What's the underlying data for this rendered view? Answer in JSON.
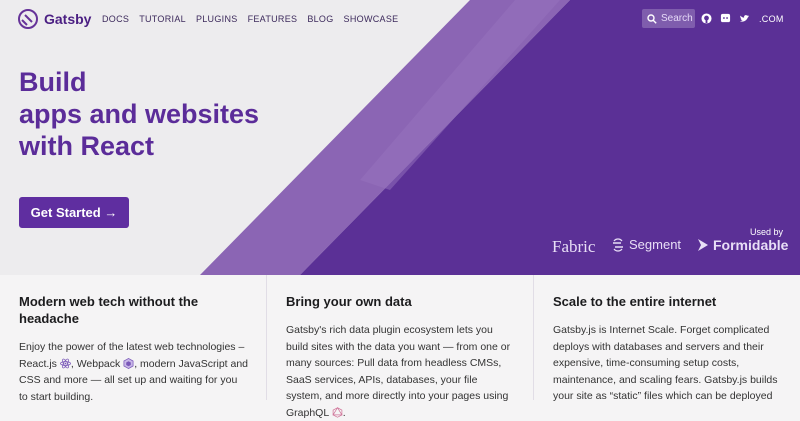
{
  "brand": {
    "name": "Gatsby"
  },
  "nav": {
    "links": [
      {
        "label": "DOCS"
      },
      {
        "label": "TUTORIAL"
      },
      {
        "label": "PLUGINS"
      },
      {
        "label": "FEATURES"
      },
      {
        "label": "BLOG"
      },
      {
        "label": "SHOWCASE"
      }
    ],
    "search_placeholder": "Search",
    "domain": ".COM"
  },
  "hero": {
    "headline": "Build\napps and websites\nwith React",
    "cta_label": "Get Started →",
    "used_by_label": "Used by",
    "partners": [
      {
        "name": "Fabric"
      },
      {
        "name": "Segment"
      },
      {
        "name": "Formidable"
      }
    ]
  },
  "features": [
    {
      "title": "Modern web tech without the headache",
      "text_parts": [
        "Enjoy the power of the latest web technologies – React.js ",
        ", Webpack ",
        ", modern JavaScript and CSS and more — all set up and waiting for you to start building."
      ]
    },
    {
      "title": "Bring your own data",
      "text_parts": [
        "Gatsby's rich data plugin ecosystem lets you build sites with the data you want — from one or many sources: Pull data from headless CMSs, SaaS services, APIs, databases, your file system, and more directly into your pages using GraphQL ",
        "."
      ]
    },
    {
      "title": "Scale to the entire internet",
      "text_parts": [
        "Gatsby.js is Internet Scale. Forget complicated deploys with databases and servers and their expensive, time-consuming setup costs, maintenance, and scaling fears. Gatsby.js builds your site as “static” files which can be deployed"
      ]
    }
  ],
  "colors": {
    "brand_purple": "#663399",
    "hero_dark": "#5b3096",
    "hero_mid": "#8b65b4",
    "headline": "#5b2c99",
    "button": "#5f2ea0"
  },
  "icons": [
    "gatsby-logo",
    "search-icon",
    "github-icon",
    "discord-icon",
    "twitter-icon",
    "segment-logo",
    "formidable-logo",
    "react-icon",
    "webpack-icon",
    "graphql-icon"
  ]
}
